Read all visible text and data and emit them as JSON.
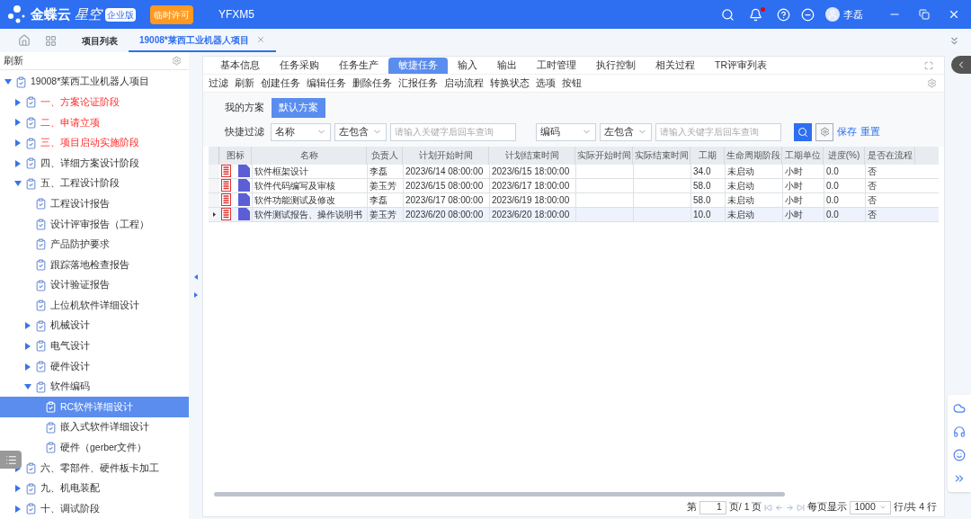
{
  "header": {
    "brand": "金蝶云",
    "brand_sub": "星空",
    "edition": "企业版",
    "license_badge": "临时许可",
    "account": "YFXM5",
    "user": "李磊",
    "notification_unread": true
  },
  "tabs": [
    {
      "label": "项目列表",
      "selected": false,
      "closable": false
    },
    {
      "label": "19008*莱西工业机器人项目",
      "selected": true,
      "closable": true
    }
  ],
  "sidebar": {
    "title": "刷新",
    "tree": [
      {
        "label": "19008*莱西工业机器人项目",
        "expanded": true,
        "selected": false,
        "highlighted": false,
        "children": [
          {
            "label": "一、方案论证阶段",
            "expanded": false,
            "selected": false,
            "highlighted": true
          },
          {
            "label": "二、申请立项",
            "expanded": false,
            "selected": false,
            "highlighted": true
          },
          {
            "label": "三、项目启动实施阶段",
            "expanded": false,
            "selected": false,
            "highlighted": true
          },
          {
            "label": "四、详细方案设计阶段",
            "expanded": false,
            "selected": false,
            "highlighted": false
          },
          {
            "label": "五、工程设计阶段",
            "expanded": true,
            "selected": false,
            "highlighted": false,
            "children": [
              {
                "label": "工程设计报告",
                "selected": false,
                "highlighted": false
              },
              {
                "label": "设计评审报告（工程）",
                "selected": false,
                "highlighted": false
              },
              {
                "label": "产品防护要求",
                "selected": false,
                "highlighted": false
              },
              {
                "label": "跟踪落地检查报告",
                "selected": false,
                "highlighted": false
              },
              {
                "label": "设计验证报告",
                "selected": false,
                "highlighted": false
              },
              {
                "label": "上位机软件详细设计",
                "selected": false,
                "highlighted": false
              },
              {
                "label": "机械设计",
                "expanded": false,
                "selected": false,
                "highlighted": false
              },
              {
                "label": "电气设计",
                "expanded": false,
                "selected": false,
                "highlighted": false
              },
              {
                "label": "硬件设计",
                "expanded": false,
                "selected": false,
                "highlighted": false
              },
              {
                "label": "软件编码",
                "expanded": true,
                "selected": false,
                "highlighted": false,
                "children": [
                  {
                    "label": "RC软件详细设计",
                    "selected": true
                  },
                  {
                    "label": "嵌入式软件详细设计",
                    "selected": false,
                    "highlighted": false
                  },
                  {
                    "label": "硬件（gerber文件）",
                    "selected": false,
                    "highlighted": false
                  }
                ]
              }
            ]
          },
          {
            "label": "六、零部件、硬件板卡加工",
            "expanded": false,
            "selected": false,
            "highlighted": false
          },
          {
            "label": "九、机电装配",
            "expanded": false,
            "selected": false,
            "highlighted": false
          },
          {
            "label": "十、调试阶段",
            "expanded": false,
            "selected": false,
            "highlighted": false
          }
        ]
      }
    ]
  },
  "panel_tabs": [
    {
      "label": "基本信息",
      "selected": false
    },
    {
      "label": "任务采购",
      "selected": false
    },
    {
      "label": "任务生产",
      "selected": false
    },
    {
      "label": "敏捷任务",
      "selected": true
    },
    {
      "label": "输入",
      "selected": false
    },
    {
      "label": "输出",
      "selected": false
    },
    {
      "label": "工时管理",
      "selected": false
    },
    {
      "label": "执行控制",
      "selected": false
    },
    {
      "label": "相关过程",
      "selected": false
    },
    {
      "label": "TR评审列表",
      "selected": false
    }
  ],
  "toolbar": [
    "过滤",
    "刷新",
    "创建任务",
    "编辑任务",
    "删除任务",
    "汇报任务",
    "启动流程",
    "转换状态",
    "选项",
    "按钮"
  ],
  "scheme": {
    "label": "我的方案",
    "options": [
      {
        "label": "默认方案",
        "selected": true
      }
    ]
  },
  "quick_filter": {
    "label": "快捷过滤",
    "groups": [
      {
        "field": "名称",
        "operator": "左包含",
        "placeholder": "请输入关键字后回车查询"
      },
      {
        "field": "编码",
        "operator": "左包含",
        "placeholder": "请输入关键字后回车查询"
      }
    ],
    "save": "保存",
    "reset": "重置"
  },
  "table": {
    "columns": [
      "图标",
      "名称",
      "负责人",
      "计划开始时间",
      "计划结束时间",
      "实际开始时间",
      "实际结束时间",
      "工期",
      "生命周期阶段",
      "工期单位",
      "进度(%)",
      "是否在流程"
    ],
    "rows": [
      {
        "selected": false,
        "cells": [
          "",
          "软件框架设计",
          "李磊",
          "2023/6/14 08:00:00",
          "2023/6/15 18:00:00",
          "",
          "",
          "34.0",
          "未启动",
          "小时",
          "0.0",
          "否"
        ]
      },
      {
        "selected": false,
        "cells": [
          "",
          "软件代码编写及审核",
          "姜玉芳",
          "2023/6/15 08:00:00",
          "2023/6/17 18:00:00",
          "",
          "",
          "58.0",
          "未启动",
          "小时",
          "0.0",
          "否"
        ]
      },
      {
        "selected": false,
        "cells": [
          "",
          "软件功能测试及修改",
          "李磊",
          "2023/6/17 08:00:00",
          "2023/6/19 18:00:00",
          "",
          "",
          "58.0",
          "未启动",
          "小时",
          "0.0",
          "否"
        ]
      },
      {
        "selected": true,
        "cells": [
          "",
          "软件测试报告、操作说明书",
          "姜玉芳",
          "2023/6/20 08:00:00",
          "2023/6/20 18:00:00",
          "",
          "",
          "10.0",
          "未启动",
          "小时",
          "0.0",
          "否"
        ]
      }
    ]
  },
  "pager": {
    "prefix": "第",
    "page": "1",
    "of_pages": "页/ 1 页",
    "per_page_label": "每页显示",
    "per_page": "1000",
    "total": "行/共 4 行"
  }
}
